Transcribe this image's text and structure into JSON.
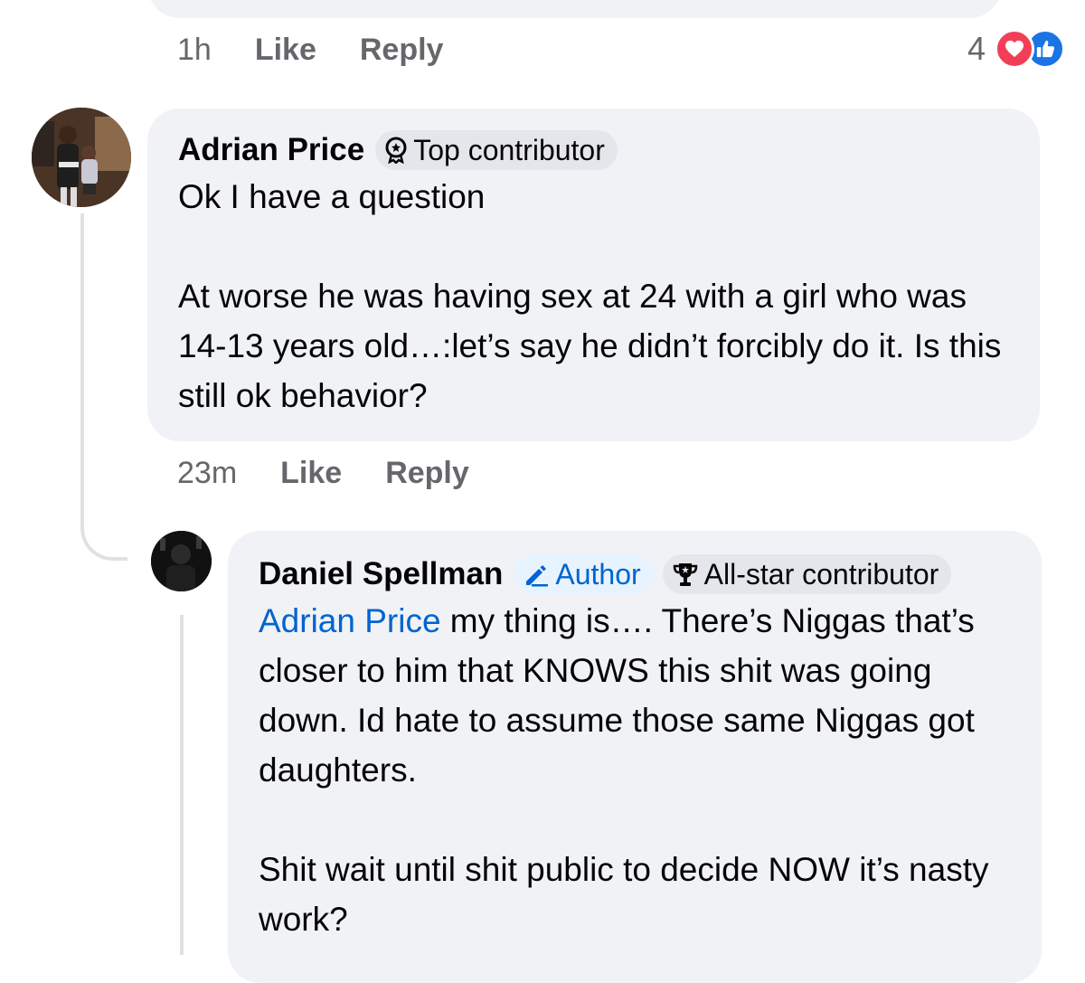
{
  "prev_comment": {
    "time": "1h",
    "like_label": "Like",
    "reply_label": "Reply",
    "reaction_count": "4",
    "reactions": [
      "heart-icon",
      "like-icon"
    ]
  },
  "comment_adrian": {
    "author": "Adrian Price",
    "badge": "Top contributor",
    "text_line1": "Ok I have a question",
    "text_para2": "At worse he was having sex at 24 with a girl who was 14-13 years old…:let’s say he didn’t forcibly do it. Is this still ok behavior?",
    "time": "23m",
    "like_label": "Like",
    "reply_label": "Reply"
  },
  "comment_daniel": {
    "author": "Daniel Spellman",
    "badge_author": "Author",
    "badge_contributor": "All-star contributor",
    "mention": "Adrian Price",
    "text_after_mention": " my thing is…. There’s Niggas that’s closer to him that KNOWS this shit was going down. Id hate to assume those same Niggas got daughters.",
    "text_para2": "Shit wait until shit public to decide NOW it’s nasty work?"
  },
  "colors": {
    "bubble": "#f0f2f5",
    "meta_text": "#65676b",
    "link_blue": "#0064d1",
    "heart": "#f33e58",
    "like": "#1b74e4"
  }
}
